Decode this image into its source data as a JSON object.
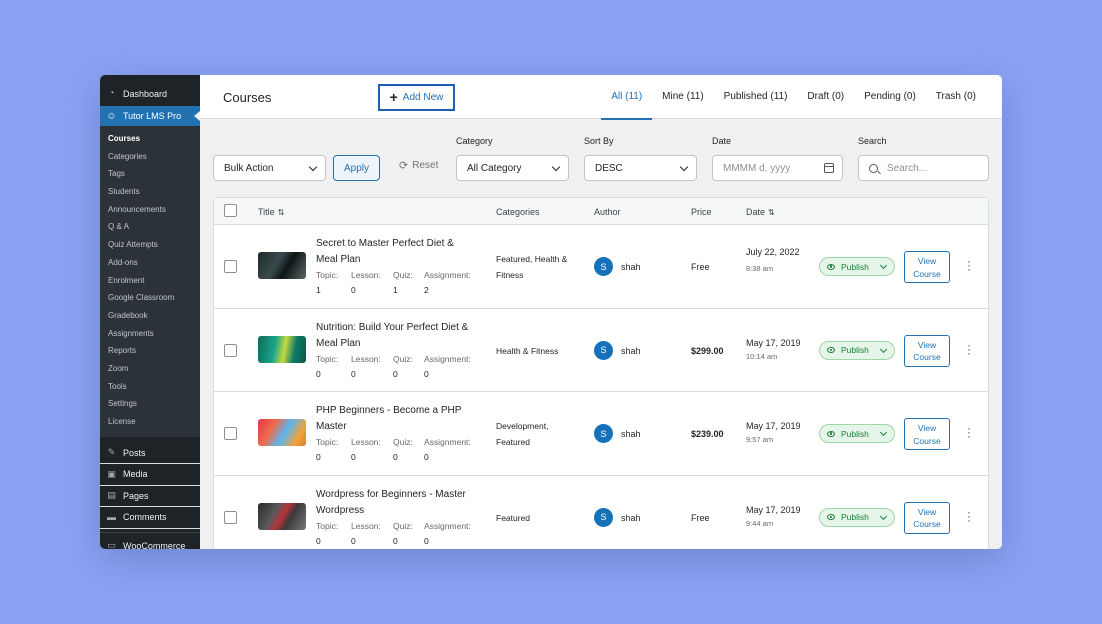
{
  "sidebar": {
    "dashboard": "Dashboard",
    "plugin": "Tutor LMS Pro",
    "submenu": [
      "Courses",
      "Categories",
      "Tags",
      "Students",
      "Announcements",
      "Q & A",
      "Quiz Attempts",
      "Add-ons",
      "Enrolment",
      "Google Classroom",
      "Gradebook",
      "Assignments",
      "Reports",
      "Zoom",
      "Tools",
      "Settings",
      "License"
    ],
    "main": [
      "Posts",
      "Media",
      "Pages",
      "Comments"
    ],
    "woo": "WooCommerce"
  },
  "header": {
    "title": "Courses",
    "add_new": "Add New",
    "tabs": [
      "All (11)",
      "Mine (11)",
      "Published (11)",
      "Draft (0)",
      "Pending (0)",
      "Trash (0)"
    ]
  },
  "filters": {
    "bulk_action": "Bulk Action",
    "apply": "Apply",
    "reset": "Reset",
    "category_label": "Category",
    "category_value": "All Category",
    "sort_label": "Sort By",
    "sort_value": "DESC",
    "date_label": "Date",
    "date_placeholder": "MMMM d, yyyy",
    "search_label": "Search",
    "search_placeholder": "Search..."
  },
  "table": {
    "headers": {
      "title": "Title",
      "categories": "Categories",
      "author": "Author",
      "price": "Price",
      "date": "Date"
    },
    "meta_labels": {
      "topic": "Topic:",
      "lesson": "Lesson:",
      "quiz": "Quiz:",
      "assignment": "Assignment:"
    },
    "status_label": "Publish",
    "view_line1": "View",
    "view_line2": "Course",
    "rows": [
      {
        "title": "Secret to Master Perfect Diet & Meal Plan",
        "topic": "1",
        "lesson": "0",
        "quiz": "1",
        "assignment": "2",
        "categories": "Featured, Health & Fitness",
        "author_initial": "S",
        "author": "shah",
        "price": "Free",
        "date": "July 22, 2022",
        "time": "8:38 am"
      },
      {
        "title": "Nutrition: Build Your Perfect Diet & Meal Plan",
        "topic": "0",
        "lesson": "0",
        "quiz": "0",
        "assignment": "0",
        "categories": "Health & Fitness",
        "author_initial": "S",
        "author": "shah",
        "price": "$299.00",
        "date": "May 17, 2019",
        "time": "10:14 am"
      },
      {
        "title": "PHP Beginners - Become a PHP Master",
        "topic": "0",
        "lesson": "0",
        "quiz": "0",
        "assignment": "0",
        "categories": "Development, Featured",
        "author_initial": "S",
        "author": "shah",
        "price": "$239.00",
        "date": "May 17, 2019",
        "time": "9:57 am"
      },
      {
        "title": "Wordpress for Beginners - Master Wordpress",
        "topic": "0",
        "lesson": "0",
        "quiz": "0",
        "assignment": "0",
        "categories": "Featured",
        "author_initial": "S",
        "author": "shah",
        "price": "Free",
        "date": "May 17, 2019",
        "time": "9:44 am"
      }
    ]
  },
  "colors": {
    "accent": "#2271b1",
    "sidebar": "#1d2327",
    "publish_green": "#1c7d35",
    "background": "#8aa3f4"
  }
}
